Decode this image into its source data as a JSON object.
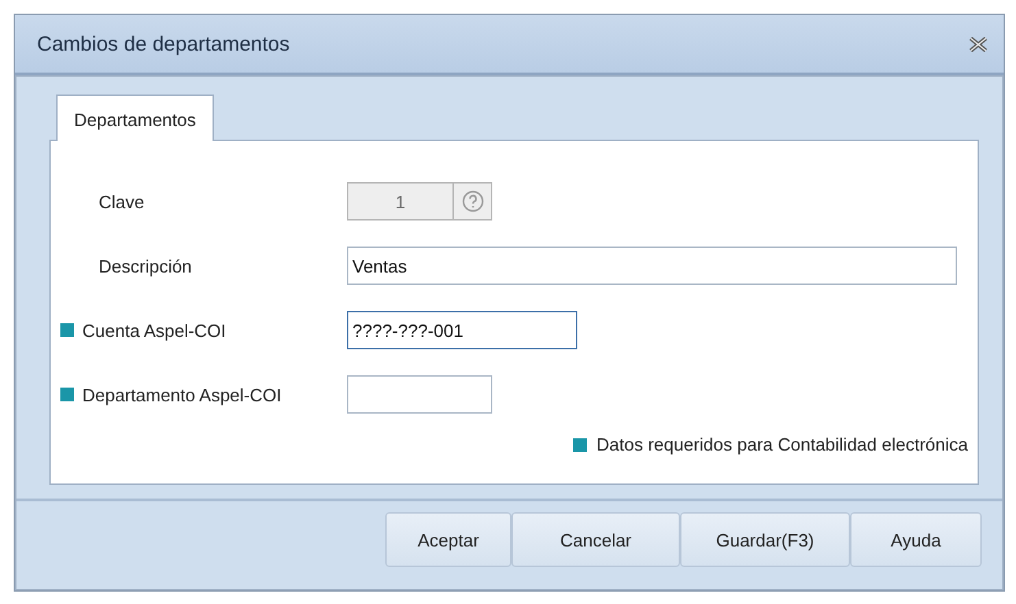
{
  "window": {
    "title": "Cambios de departamentos"
  },
  "tabs": [
    {
      "label": "Departamentos",
      "selected": true
    }
  ],
  "fields": [
    {
      "label": "Clave",
      "value": "1",
      "kind": "lookup",
      "disabled": true,
      "required": false,
      "focused": false
    },
    {
      "label": "Descripción",
      "value": "Ventas",
      "kind": "wide",
      "disabled": false,
      "required": false,
      "focused": false
    },
    {
      "label": "Cuenta Aspel-COI",
      "value": "????-???-001",
      "kind": "medium",
      "disabled": false,
      "required": true,
      "focused": true
    },
    {
      "label": "Departamento Aspel-COI",
      "kind": "short",
      "disabled": false,
      "required": true,
      "focused": false
    }
  ],
  "legend": {
    "text": "Datos requeridos para Contabilidad electrónica",
    "color": "#1a96a8"
  },
  "buttons": [
    "Aceptar",
    "Cancelar",
    "Guardar(F3)",
    "Ayuda"
  ]
}
